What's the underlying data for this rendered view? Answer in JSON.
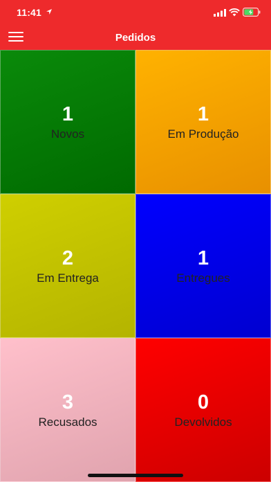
{
  "status_bar": {
    "time": "11:41",
    "icons": [
      "location-icon",
      "signal-icon",
      "wifi-icon",
      "battery-icon"
    ]
  },
  "header": {
    "title": "Pedidos",
    "menu_icon": "hamburger-menu-icon",
    "background": "#ee2a2c"
  },
  "tiles": [
    {
      "count": "1",
      "label": "Novos",
      "color": "#008000"
    },
    {
      "count": "1",
      "label": "Em Produção",
      "color": "#ffa500"
    },
    {
      "count": "2",
      "label": "Em Entrega",
      "color": "#c8c800"
    },
    {
      "count": "1",
      "label": "Entregues",
      "color": "#0000ff"
    },
    {
      "count": "3",
      "label": "Recusados",
      "color": "#ffc0cb"
    },
    {
      "count": "0",
      "label": "Devolvidos",
      "color": "#ff0000"
    }
  ]
}
